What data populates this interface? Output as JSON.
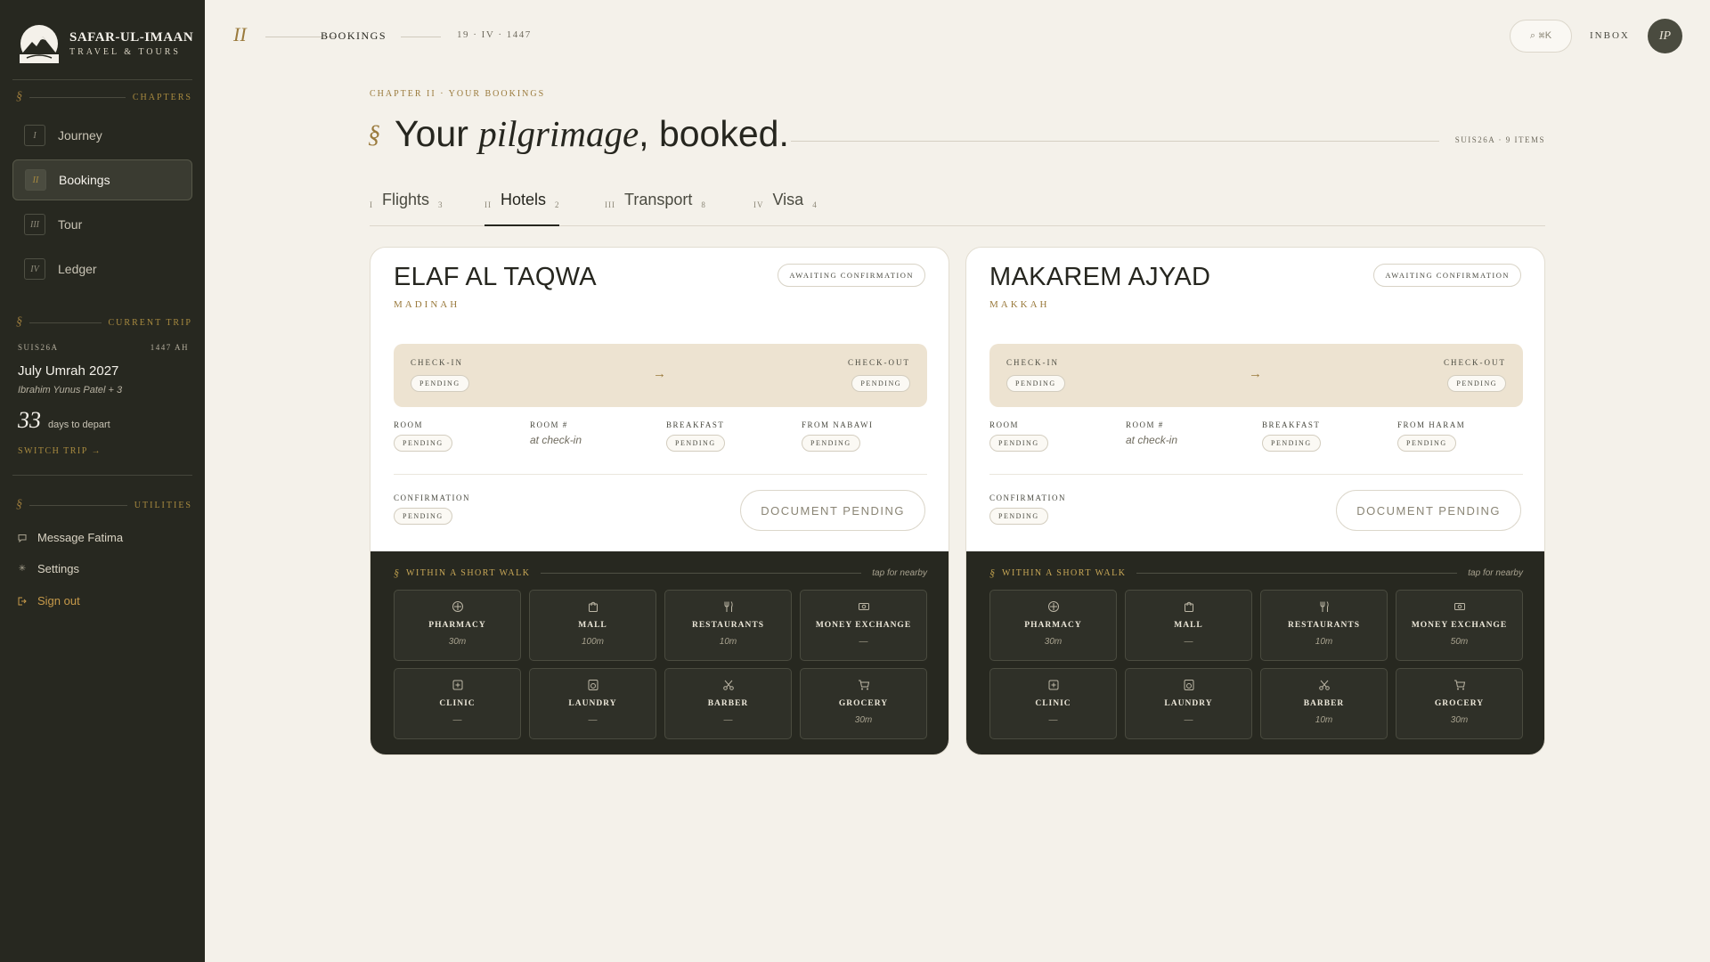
{
  "brand": {
    "name": "SAFAR-UL-IMAAN",
    "sub": "TRAVEL & TOURS"
  },
  "sidebar": {
    "chapters_title": "CHAPTERS",
    "nav": [
      {
        "numeral": "I",
        "label": "Journey",
        "active": false
      },
      {
        "numeral": "II",
        "label": "Bookings",
        "active": true
      },
      {
        "numeral": "III",
        "label": "Tour",
        "active": false
      },
      {
        "numeral": "IV",
        "label": "Ledger",
        "active": false
      }
    ],
    "current_trip_title": "CURRENT TRIP",
    "trip": {
      "code": "SUIS26A",
      "year": "1447 AH",
      "name": "July Umrah 2027",
      "pax": "Ibrahim Yunus Patel + 3",
      "days": "33",
      "days_label": "days to depart",
      "switch": "SWITCH TRIP →"
    },
    "utilities_title": "UTILITIES",
    "utilities": [
      {
        "icon": "chat-icon",
        "label": "Message Fatima"
      },
      {
        "icon": "gear-icon",
        "label": "Settings"
      },
      {
        "icon": "sign-out-icon",
        "label": "Sign out"
      }
    ]
  },
  "topbar": {
    "roman": "II",
    "section": "BOOKINGS",
    "date": "19 · IV · 1447",
    "search": "⌕ ⌘K",
    "inbox": "INBOX",
    "avatar": "IP"
  },
  "header": {
    "eyebrow": "CHAPTER II · YOUR BOOKINGS",
    "sig": "§",
    "title_a": "Your ",
    "title_em": "pilgrimage",
    "title_b": ", booked.",
    "meta": "SUIS26A · 9 ITEMS"
  },
  "tabs": [
    {
      "numeral": "I",
      "label": "Flights",
      "count": "3",
      "active": false
    },
    {
      "numeral": "II",
      "label": "Hotels",
      "count": "2",
      "active": true
    },
    {
      "numeral": "III",
      "label": "Transport",
      "count": "8",
      "active": false
    },
    {
      "numeral": "IV",
      "label": "Visa",
      "count": "4",
      "active": false
    }
  ],
  "hotels": [
    {
      "name": "ELAF AL TAQWA",
      "city": "MADINAH",
      "status": "AWAITING CONFIRMATION",
      "checkin_label": "CHECK-IN",
      "checkin": "PENDING",
      "checkout_label": "CHECK-OUT",
      "checkout": "PENDING",
      "arrow": "→",
      "details": [
        {
          "label": "ROOM",
          "value": "PENDING",
          "pill": true
        },
        {
          "label": "ROOM #",
          "value": "at check-in",
          "pill": false
        },
        {
          "label": "BREAKFAST",
          "value": "PENDING",
          "pill": true
        },
        {
          "label": "FROM NABAWI",
          "value": "PENDING",
          "pill": true
        }
      ],
      "confirmation_label": "CONFIRMATION",
      "confirmation": "PENDING",
      "document": "DOCUMENT PENDING",
      "nearby_sig": "§",
      "nearby_title": "WITHIN A SHORT WALK",
      "nearby_hint": "tap for nearby",
      "nearby": [
        {
          "icon": "pharmacy-icon",
          "name": "PHARMACY",
          "dist": "30m"
        },
        {
          "icon": "mall-icon",
          "name": "MALL",
          "dist": "100m"
        },
        {
          "icon": "restaurant-icon",
          "name": "RESTAURANTS",
          "dist": "10m"
        },
        {
          "icon": "money-exchange-icon",
          "name": "MONEY EXCHANGE",
          "dist": "—"
        },
        {
          "icon": "clinic-icon",
          "name": "CLINIC",
          "dist": "—"
        },
        {
          "icon": "laundry-icon",
          "name": "LAUNDRY",
          "dist": "—"
        },
        {
          "icon": "barber-icon",
          "name": "BARBER",
          "dist": "—"
        },
        {
          "icon": "grocery-icon",
          "name": "GROCERY",
          "dist": "30m"
        }
      ]
    },
    {
      "name": "MAKAREM AJYAD",
      "city": "MAKKAH",
      "status": "AWAITING CONFIRMATION",
      "checkin_label": "CHECK-IN",
      "checkin": "PENDING",
      "checkout_label": "CHECK-OUT",
      "checkout": "PENDING",
      "arrow": "→",
      "details": [
        {
          "label": "ROOM",
          "value": "PENDING",
          "pill": true
        },
        {
          "label": "ROOM #",
          "value": "at check-in",
          "pill": false
        },
        {
          "label": "BREAKFAST",
          "value": "PENDING",
          "pill": true
        },
        {
          "label": "FROM HARAM",
          "value": "PENDING",
          "pill": true
        }
      ],
      "confirmation_label": "CONFIRMATION",
      "confirmation": "PENDING",
      "document": "DOCUMENT PENDING",
      "nearby_sig": "§",
      "nearby_title": "WITHIN A SHORT WALK",
      "nearby_hint": "tap for nearby",
      "nearby": [
        {
          "icon": "pharmacy-icon",
          "name": "PHARMACY",
          "dist": "30m"
        },
        {
          "icon": "mall-icon",
          "name": "MALL",
          "dist": "—"
        },
        {
          "icon": "restaurant-icon",
          "name": "RESTAURANTS",
          "dist": "10m"
        },
        {
          "icon": "money-exchange-icon",
          "name": "MONEY EXCHANGE",
          "dist": "50m"
        },
        {
          "icon": "clinic-icon",
          "name": "CLINIC",
          "dist": "—"
        },
        {
          "icon": "laundry-icon",
          "name": "LAUNDRY",
          "dist": "—"
        },
        {
          "icon": "barber-icon",
          "name": "BARBER",
          "dist": "10m"
        },
        {
          "icon": "grocery-icon",
          "name": "GROCERY",
          "dist": "30m"
        }
      ]
    }
  ]
}
